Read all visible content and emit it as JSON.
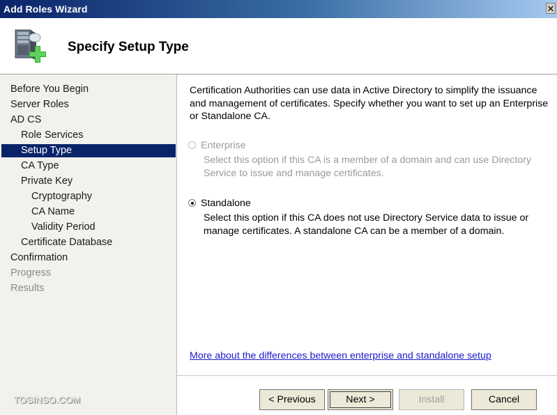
{
  "window": {
    "title": "Add Roles Wizard",
    "close_glyph": "✕"
  },
  "header": {
    "title": "Specify Setup Type",
    "icon": "server-add-icon"
  },
  "sidebar": {
    "items": [
      {
        "label": "Before You Begin",
        "state": "normal"
      },
      {
        "label": "Server Roles",
        "state": "normal"
      },
      {
        "label": "AD CS",
        "state": "normal"
      },
      {
        "label": "Role Services",
        "state": "normal"
      },
      {
        "label": "Setup Type",
        "state": "selected"
      },
      {
        "label": "CA Type",
        "state": "normal"
      },
      {
        "label": "Private Key",
        "state": "normal"
      },
      {
        "label": "Cryptography",
        "state": "normal"
      },
      {
        "label": "CA Name",
        "state": "normal"
      },
      {
        "label": "Validity Period",
        "state": "normal"
      },
      {
        "label": "Certificate Database",
        "state": "normal"
      },
      {
        "label": "Confirmation",
        "state": "normal"
      },
      {
        "label": "Progress",
        "state": "disabled"
      },
      {
        "label": "Results",
        "state": "disabled"
      }
    ],
    "watermark": "TOSINSO.COM"
  },
  "main": {
    "description": "Certification Authorities can use data in Active Directory to simplify the issuance and management of certificates. Specify whether you want to set up an Enterprise or Standalone CA.",
    "options": [
      {
        "label": "Enterprise",
        "checked": false,
        "enabled": false,
        "description": "Select this option if this CA is a member of a domain and can use Directory Service to issue and manage certificates."
      },
      {
        "label": "Standalone",
        "checked": true,
        "enabled": true,
        "description": "Select this option if this CA does not use Directory Service data to issue or manage certificates. A standalone CA can be a member of a domain."
      }
    ],
    "help_link": "More about the differences between enterprise and standalone setup"
  },
  "buttons": {
    "previous": "< Previous",
    "next": "Next >",
    "install": "Install",
    "cancel": "Cancel"
  },
  "colors": {
    "selection": "#0a246a",
    "link": "#1a1acc",
    "title_bar_start": "#0a246a"
  }
}
